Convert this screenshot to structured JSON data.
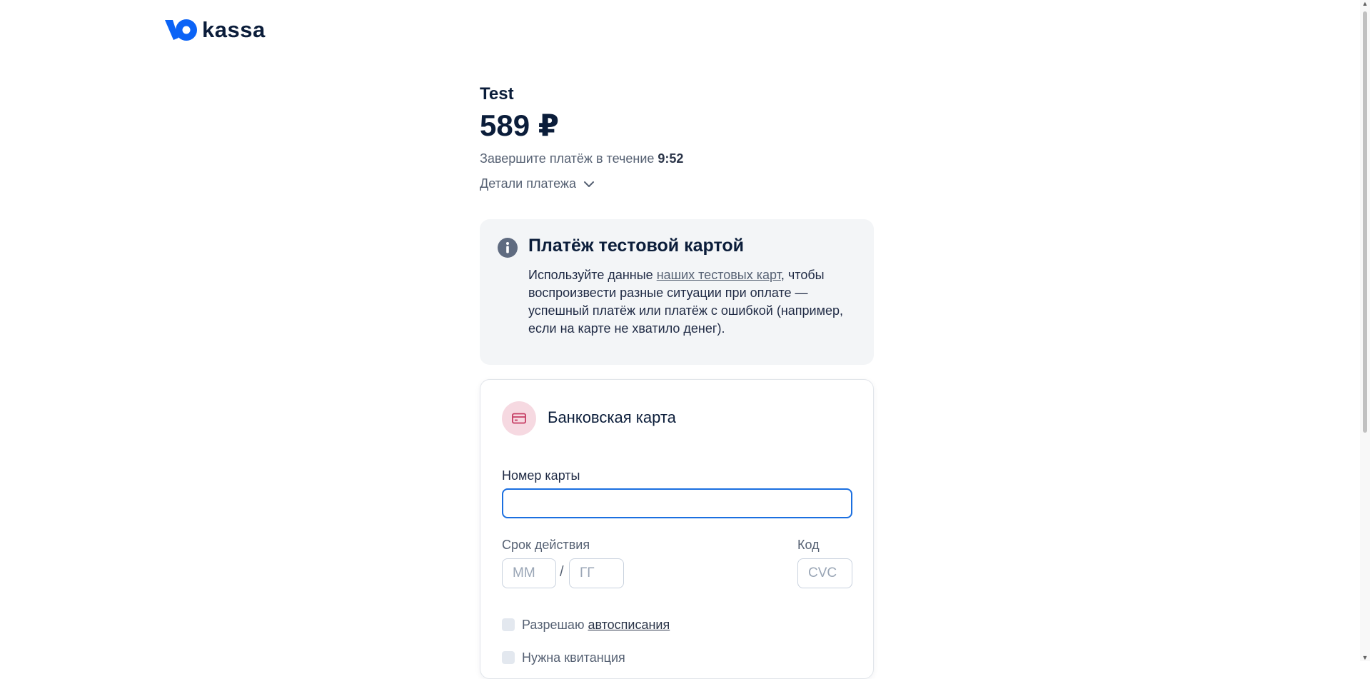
{
  "brand": {
    "logo_text": "kassa",
    "accent": "#1b6fe0"
  },
  "order": {
    "shop_name": "Test",
    "amount": "589 ₽",
    "timer_prefix": "Завершите платёж в течение",
    "timer_value": "9:52",
    "details_label": "Детали платежа"
  },
  "info": {
    "title": "Платёж тестовой картой",
    "text_before": "Используйте данные ",
    "link": "наших тестовых карт",
    "text_after": ", чтобы воспроизвести разные ситуации при оплате — успешный платёж или платёж с ошибкой (например, если на карте не хватило денег)."
  },
  "card_form": {
    "title": "Банковская карта",
    "card_number_label": "Номер карты",
    "card_number_value": "",
    "expiry_label": "Срок действия",
    "month_placeholder": "ММ",
    "year_placeholder": "ГГ",
    "slash": "/",
    "cvc_label": "Код",
    "cvc_placeholder": "CVC",
    "autopay_text": "Разрешаю ",
    "autopay_link": "автосписания",
    "receipt_label": "Нужна квитанция"
  }
}
